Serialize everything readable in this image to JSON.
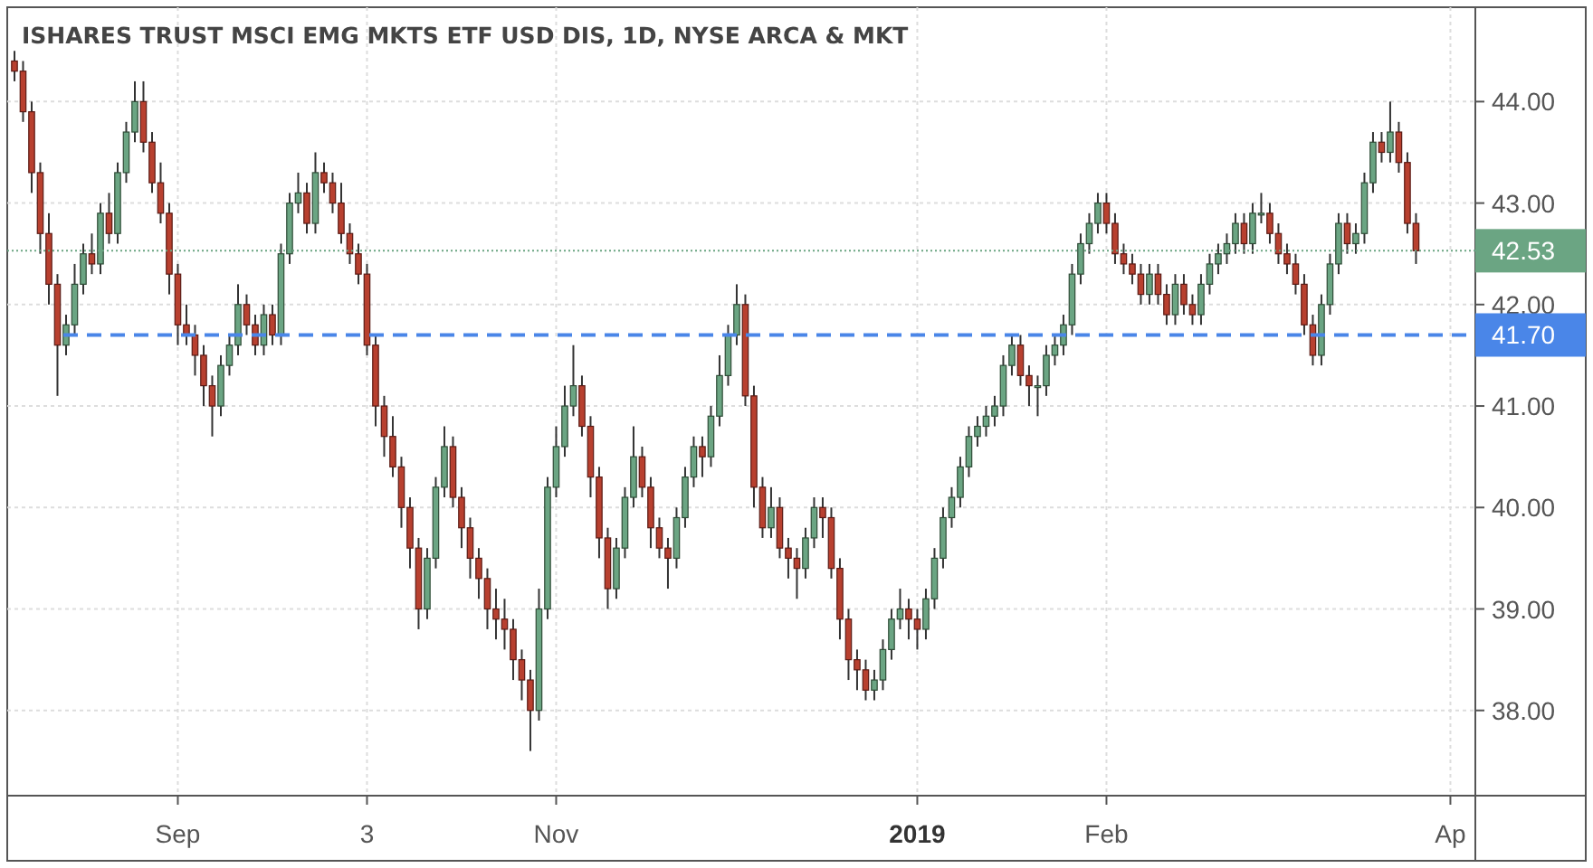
{
  "chart_data": {
    "type": "candlestick",
    "title": "ISHARES TRUST MSCI EMG MKTS ETF USD DIS, 1D, NYSE ARCA & MKT",
    "ylim": [
      37.16,
      44.93
    ],
    "grid": true,
    "categories": [
      null,
      null,
      null,
      null,
      null,
      null,
      null,
      null,
      null,
      null,
      null,
      null,
      null,
      null,
      null,
      null,
      null,
      null,
      null,
      "Sep",
      null,
      null,
      null,
      null,
      null,
      null,
      null,
      null,
      null,
      null,
      null,
      null,
      null,
      null,
      null,
      null,
      null,
      null,
      null,
      null,
      null,
      "3",
      null,
      null,
      null,
      null,
      null,
      null,
      null,
      null,
      null,
      null,
      null,
      null,
      null,
      null,
      null,
      null,
      null,
      null,
      null,
      null,
      null,
      "Nov",
      null,
      null,
      null,
      null,
      null,
      null,
      null,
      null,
      null,
      null,
      null,
      null,
      null,
      null,
      null,
      null,
      null,
      null,
      null,
      null,
      null,
      null,
      null,
      null,
      null,
      null,
      null,
      null,
      null,
      null,
      null,
      null,
      null,
      null,
      null,
      null,
      null,
      null,
      null,
      null,
      null,
      "**2019**",
      null,
      null,
      null,
      null,
      null,
      null,
      null,
      null,
      null,
      null,
      null,
      null,
      null,
      null,
      null,
      null,
      null,
      null,
      null,
      null,
      null,
      "Feb",
      null,
      null,
      null,
      null,
      null,
      null,
      null,
      null,
      null,
      null,
      null,
      null,
      null,
      null,
      null,
      null,
      null,
      null,
      null,
      null,
      null,
      null,
      null,
      null,
      null,
      null,
      null,
      null,
      null,
      null,
      null,
      null,
      null,
      null,
      null,
      null,
      null,
      null,
      null,
      "Ap"
    ],
    "yticks": [
      {
        "value": 44,
        "label": "44.00"
      },
      {
        "value": 43,
        "label": "43.00"
      },
      {
        "value": 42,
        "label": "42.00"
      },
      {
        "value": 41,
        "label": "41.00"
      },
      {
        "value": 40,
        "label": "40.00"
      },
      {
        "value": 39,
        "label": "39.00"
      },
      {
        "value": 38,
        "label": "38.00"
      }
    ],
    "ref_lines": [
      {
        "axis": "y",
        "value": 42.53,
        "label": "42.53",
        "color": "#6ba583"
      },
      {
        "axis": "y",
        "value": 41.7,
        "label": "41.70",
        "color": "#4a86e8"
      }
    ],
    "ohlc": [
      [
        44.4,
        44.5,
        44.2,
        44.3
      ],
      [
        44.3,
        44.4,
        43.8,
        43.9
      ],
      [
        43.9,
        44.0,
        43.1,
        43.3
      ],
      [
        43.3,
        43.4,
        42.5,
        42.7
      ],
      [
        42.7,
        42.9,
        42.0,
        42.2
      ],
      [
        42.2,
        42.3,
        41.1,
        41.6
      ],
      [
        41.6,
        41.9,
        41.5,
        41.8
      ],
      [
        41.8,
        42.4,
        41.7,
        42.2
      ],
      [
        42.2,
        42.6,
        42.1,
        42.5
      ],
      [
        42.5,
        42.7,
        42.3,
        42.4
      ],
      [
        42.4,
        43.0,
        42.3,
        42.9
      ],
      [
        42.9,
        43.1,
        42.6,
        42.7
      ],
      [
        42.7,
        43.4,
        42.6,
        43.3
      ],
      [
        43.3,
        43.8,
        43.2,
        43.7
      ],
      [
        43.7,
        44.2,
        43.6,
        44.0
      ],
      [
        44.0,
        44.2,
        43.5,
        43.6
      ],
      [
        43.6,
        43.7,
        43.1,
        43.2
      ],
      [
        43.2,
        43.4,
        42.8,
        42.9
      ],
      [
        42.9,
        43.0,
        42.1,
        42.3
      ],
      [
        42.3,
        42.4,
        41.6,
        41.8
      ],
      [
        41.8,
        42.0,
        41.6,
        41.7
      ],
      [
        41.7,
        41.8,
        41.3,
        41.5
      ],
      [
        41.5,
        41.6,
        41.0,
        41.2
      ],
      [
        41.2,
        41.3,
        40.7,
        41.0
      ],
      [
        41.0,
        41.5,
        40.9,
        41.4
      ],
      [
        41.4,
        41.7,
        41.3,
        41.6
      ],
      [
        41.6,
        42.2,
        41.5,
        42.0
      ],
      [
        42.0,
        42.1,
        41.7,
        41.8
      ],
      [
        41.8,
        41.9,
        41.5,
        41.6
      ],
      [
        41.6,
        42.0,
        41.5,
        41.9
      ],
      [
        41.9,
        42.0,
        41.6,
        41.7
      ],
      [
        41.7,
        42.6,
        41.6,
        42.5
      ],
      [
        42.5,
        43.1,
        42.4,
        43.0
      ],
      [
        43.0,
        43.3,
        42.9,
        43.1
      ],
      [
        43.1,
        43.2,
        42.7,
        42.8
      ],
      [
        42.8,
        43.5,
        42.7,
        43.3
      ],
      [
        43.3,
        43.4,
        43.1,
        43.2
      ],
      [
        43.2,
        43.3,
        42.9,
        43.0
      ],
      [
        43.0,
        43.2,
        42.6,
        42.7
      ],
      [
        42.7,
        42.8,
        42.4,
        42.5
      ],
      [
        42.5,
        42.6,
        42.2,
        42.3
      ],
      [
        42.3,
        42.4,
        41.5,
        41.6
      ],
      [
        41.6,
        41.7,
        40.8,
        41.0
      ],
      [
        41.0,
        41.1,
        40.5,
        40.7
      ],
      [
        40.7,
        40.9,
        40.3,
        40.4
      ],
      [
        40.4,
        40.5,
        39.8,
        40.0
      ],
      [
        40.0,
        40.1,
        39.4,
        39.6
      ],
      [
        39.6,
        39.7,
        38.8,
        39.0
      ],
      [
        39.0,
        39.6,
        38.9,
        39.5
      ],
      [
        39.5,
        40.3,
        39.4,
        40.2
      ],
      [
        40.2,
        40.8,
        40.1,
        40.6
      ],
      [
        40.6,
        40.7,
        40.0,
        40.1
      ],
      [
        40.1,
        40.2,
        39.6,
        39.8
      ],
      [
        39.8,
        39.9,
        39.3,
        39.5
      ],
      [
        39.5,
        39.6,
        39.1,
        39.3
      ],
      [
        39.3,
        39.4,
        38.8,
        39.0
      ],
      [
        39.0,
        39.2,
        38.7,
        38.9
      ],
      [
        38.9,
        39.1,
        38.6,
        38.8
      ],
      [
        38.8,
        38.9,
        38.3,
        38.5
      ],
      [
        38.5,
        38.6,
        38.1,
        38.3
      ],
      [
        38.3,
        38.4,
        37.6,
        38.0
      ],
      [
        38.0,
        39.2,
        37.9,
        39.0
      ],
      [
        39.0,
        40.3,
        38.9,
        40.2
      ],
      [
        40.2,
        40.8,
        40.1,
        40.6
      ],
      [
        40.6,
        41.2,
        40.5,
        41.0
      ],
      [
        41.0,
        41.6,
        40.9,
        41.2
      ],
      [
        41.2,
        41.3,
        40.7,
        40.8
      ],
      [
        40.8,
        40.9,
        40.1,
        40.3
      ],
      [
        40.3,
        40.4,
        39.5,
        39.7
      ],
      [
        39.7,
        39.8,
        39.0,
        39.2
      ],
      [
        39.2,
        39.7,
        39.1,
        39.6
      ],
      [
        39.6,
        40.2,
        39.5,
        40.1
      ],
      [
        40.1,
        40.8,
        40.0,
        40.5
      ],
      [
        40.5,
        40.6,
        40.1,
        40.2
      ],
      [
        40.2,
        40.3,
        39.6,
        39.8
      ],
      [
        39.8,
        39.9,
        39.5,
        39.6
      ],
      [
        39.6,
        39.7,
        39.2,
        39.5
      ],
      [
        39.5,
        40.0,
        39.4,
        39.9
      ],
      [
        39.9,
        40.4,
        39.8,
        40.3
      ],
      [
        40.3,
        40.7,
        40.2,
        40.6
      ],
      [
        40.6,
        40.7,
        40.3,
        40.5
      ],
      [
        40.5,
        41.0,
        40.4,
        40.9
      ],
      [
        40.9,
        41.5,
        40.8,
        41.3
      ],
      [
        41.3,
        41.8,
        41.2,
        41.7
      ],
      [
        41.7,
        42.2,
        41.6,
        42.0
      ],
      [
        42.0,
        42.1,
        41.0,
        41.1
      ],
      [
        41.1,
        41.2,
        40.0,
        40.2
      ],
      [
        40.2,
        40.3,
        39.7,
        39.8
      ],
      [
        39.8,
        40.2,
        39.7,
        40.0
      ],
      [
        40.0,
        40.1,
        39.5,
        39.6
      ],
      [
        39.6,
        39.7,
        39.3,
        39.5
      ],
      [
        39.5,
        39.6,
        39.1,
        39.4
      ],
      [
        39.4,
        39.8,
        39.3,
        39.7
      ],
      [
        39.7,
        40.1,
        39.6,
        40.0
      ],
      [
        40.0,
        40.1,
        39.7,
        39.9
      ],
      [
        39.9,
        40.0,
        39.3,
        39.4
      ],
      [
        39.4,
        39.5,
        38.7,
        38.9
      ],
      [
        38.9,
        39.0,
        38.3,
        38.5
      ],
      [
        38.5,
        38.6,
        38.2,
        38.4
      ],
      [
        38.4,
        38.5,
        38.1,
        38.2
      ],
      [
        38.2,
        38.4,
        38.1,
        38.3
      ],
      [
        38.3,
        38.7,
        38.2,
        38.6
      ],
      [
        38.6,
        39.0,
        38.5,
        38.9
      ],
      [
        38.9,
        39.2,
        38.8,
        39.0
      ],
      [
        39.0,
        39.1,
        38.7,
        38.9
      ],
      [
        38.9,
        39.0,
        38.6,
        38.8
      ],
      [
        38.8,
        39.2,
        38.7,
        39.1
      ],
      [
        39.1,
        39.6,
        39.0,
        39.5
      ],
      [
        39.5,
        40.0,
        39.4,
        39.9
      ],
      [
        39.9,
        40.2,
        39.8,
        40.1
      ],
      [
        40.1,
        40.5,
        40.0,
        40.4
      ],
      [
        40.4,
        40.8,
        40.3,
        40.7
      ],
      [
        40.7,
        40.9,
        40.6,
        40.8
      ],
      [
        40.8,
        41.0,
        40.7,
        40.9
      ],
      [
        40.9,
        41.1,
        40.8,
        41.0
      ],
      [
        41.0,
        41.5,
        40.9,
        41.4
      ],
      [
        41.4,
        41.7,
        41.3,
        41.6
      ],
      [
        41.6,
        41.7,
        41.2,
        41.3
      ],
      [
        41.3,
        41.4,
        41.0,
        41.2
      ],
      [
        41.2,
        41.3,
        40.9,
        41.2
      ],
      [
        41.2,
        41.6,
        41.1,
        41.5
      ],
      [
        41.5,
        41.7,
        41.4,
        41.6
      ],
      [
        41.6,
        41.9,
        41.5,
        41.8
      ],
      [
        41.8,
        42.4,
        41.7,
        42.3
      ],
      [
        42.3,
        42.7,
        42.2,
        42.6
      ],
      [
        42.6,
        42.9,
        42.5,
        42.8
      ],
      [
        42.8,
        43.1,
        42.7,
        43.0
      ],
      [
        43.0,
        43.1,
        42.7,
        42.8
      ],
      [
        42.8,
        42.9,
        42.4,
        42.5
      ],
      [
        42.5,
        42.6,
        42.3,
        42.4
      ],
      [
        42.4,
        42.5,
        42.2,
        42.3
      ],
      [
        42.3,
        42.4,
        42.0,
        42.1
      ],
      [
        42.1,
        42.4,
        42.0,
        42.3
      ],
      [
        42.3,
        42.4,
        42.0,
        42.1
      ],
      [
        42.1,
        42.2,
        41.8,
        41.9
      ],
      [
        41.9,
        42.3,
        41.8,
        42.2
      ],
      [
        42.2,
        42.3,
        41.9,
        42.0
      ],
      [
        42.0,
        42.1,
        41.8,
        41.9
      ],
      [
        41.9,
        42.3,
        41.8,
        42.2
      ],
      [
        42.2,
        42.5,
        42.1,
        42.4
      ],
      [
        42.4,
        42.6,
        42.3,
        42.5
      ],
      [
        42.5,
        42.7,
        42.4,
        42.6
      ],
      [
        42.6,
        42.9,
        42.5,
        42.8
      ],
      [
        42.8,
        42.9,
        42.5,
        42.6
      ],
      [
        42.6,
        43.0,
        42.5,
        42.9
      ],
      [
        42.9,
        43.1,
        42.8,
        42.9
      ],
      [
        42.9,
        43.0,
        42.6,
        42.7
      ],
      [
        42.7,
        42.8,
        42.4,
        42.5
      ],
      [
        42.5,
        42.6,
        42.3,
        42.4
      ],
      [
        42.4,
        42.5,
        42.1,
        42.2
      ],
      [
        42.2,
        42.3,
        41.7,
        41.8
      ],
      [
        41.8,
        41.9,
        41.4,
        41.5
      ],
      [
        41.5,
        42.1,
        41.4,
        42.0
      ],
      [
        42.0,
        42.5,
        41.9,
        42.4
      ],
      [
        42.4,
        42.9,
        42.3,
        42.8
      ],
      [
        42.8,
        42.9,
        42.5,
        42.6
      ],
      [
        42.6,
        42.8,
        42.5,
        42.7
      ],
      [
        42.7,
        43.3,
        42.6,
        43.2
      ],
      [
        43.2,
        43.7,
        43.1,
        43.6
      ],
      [
        43.6,
        43.7,
        43.4,
        43.5
      ],
      [
        43.5,
        44.0,
        43.4,
        43.7
      ],
      [
        43.7,
        43.8,
        43.3,
        43.4
      ],
      [
        43.4,
        43.5,
        42.7,
        42.8
      ],
      [
        42.8,
        42.9,
        42.4,
        42.53
      ],
      null,
      null,
      null,
      null
    ]
  }
}
